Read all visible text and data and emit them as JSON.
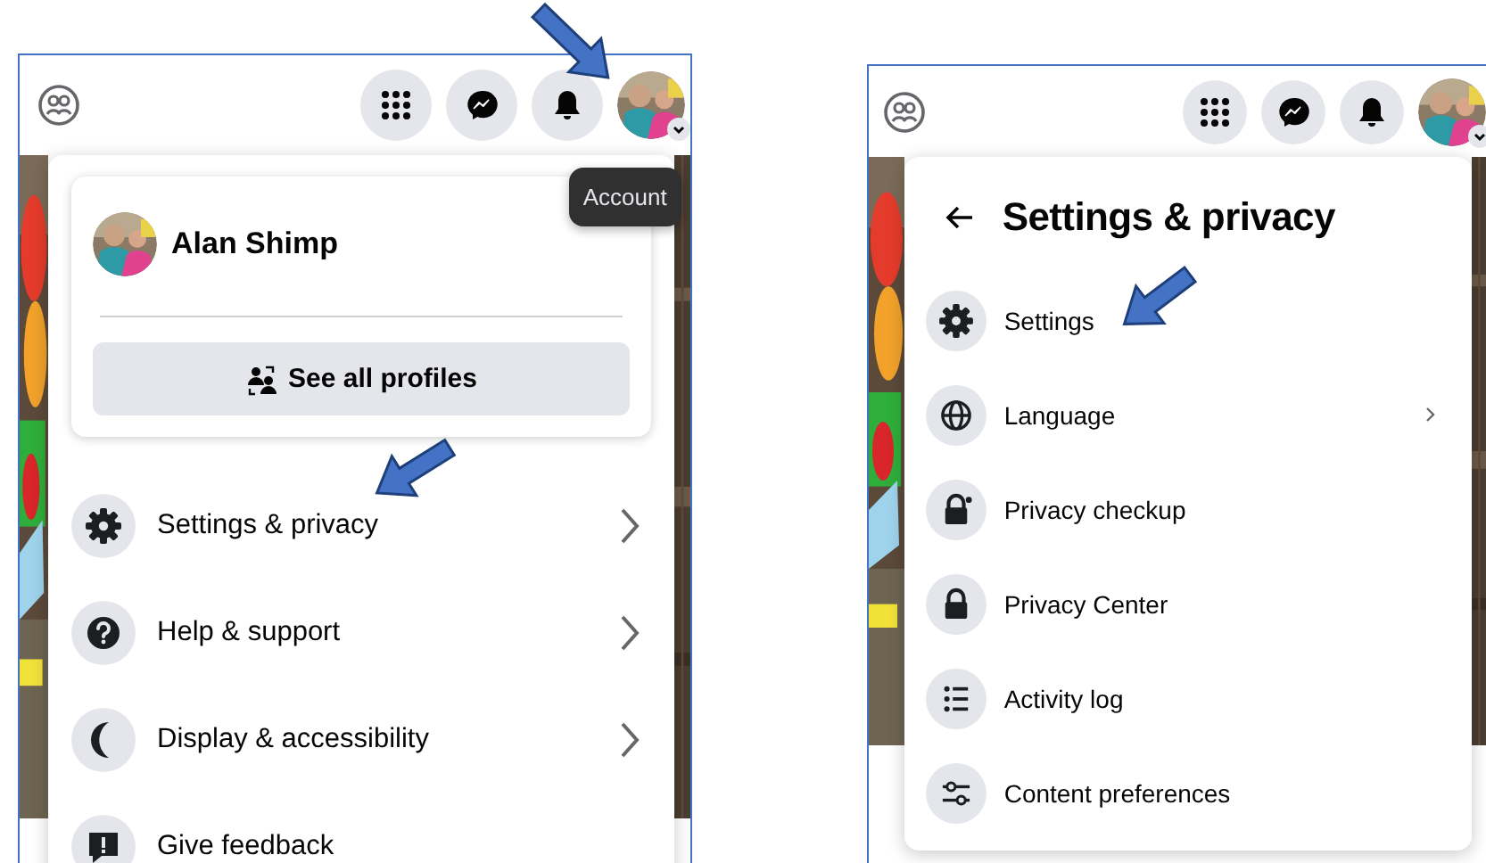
{
  "account_panel": {
    "tooltip": "Account",
    "profile": {
      "name": "Alan Shimp",
      "button": "See all profiles"
    },
    "items": [
      {
        "label": "Settings & privacy",
        "submenu": true
      },
      {
        "label": "Help & support",
        "submenu": true
      },
      {
        "label": "Display & accessibility",
        "submenu": true
      },
      {
        "label": "Give feedback",
        "submenu": false
      }
    ]
  },
  "settings_panel": {
    "title": "Settings & privacy",
    "items": [
      {
        "label": "Settings",
        "submenu": false
      },
      {
        "label": "Language",
        "submenu": true
      },
      {
        "label": "Privacy checkup",
        "submenu": false
      },
      {
        "label": "Privacy Center",
        "submenu": false
      },
      {
        "label": "Activity log",
        "submenu": false
      },
      {
        "label": "Content preferences",
        "submenu": false
      }
    ]
  }
}
